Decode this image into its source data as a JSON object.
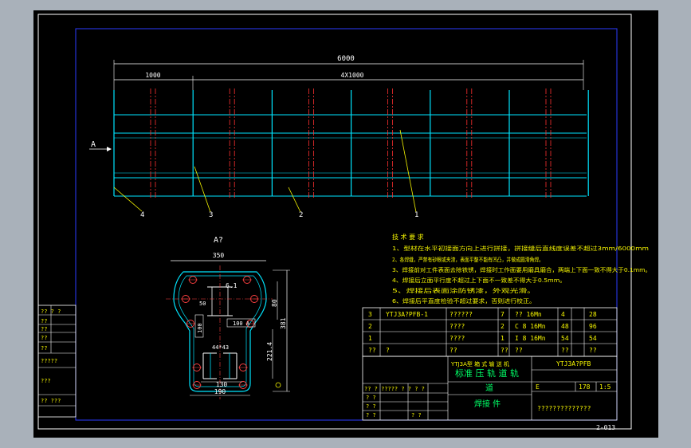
{
  "colors": {
    "background": "#000000",
    "border": "#ffffff",
    "inner_frame": "#2b3bff",
    "steel": "#00e5ff",
    "center_line": "#ff3030",
    "text": "#ffffff",
    "notes": "#f5f500",
    "detail": "#ff4040",
    "dimension": "#ffffff",
    "table_line": "#ffffff",
    "table_text": "#f5f500",
    "title_text": "#00ff66"
  },
  "drawing": {
    "dim_total": "6000",
    "dim_first": "1000",
    "dim_spacing": "4X1000",
    "section_marker": "A",
    "callouts": [
      "4",
      "3",
      "2",
      "1"
    ],
    "section_view_title": "A?",
    "section_dims": {
      "width_top": "350",
      "height_right": "381",
      "dim_80": "80",
      "dim_221": "221.4",
      "dim_50": "50",
      "dim_100a": "100 A",
      "dim_100": "100",
      "dim_130": "130",
      "dim_190": "190",
      "dim_443": "44*43",
      "dim_61": "6.1"
    },
    "sheet_number": "2-013"
  },
  "notes": {
    "title": "技 术 要 求",
    "lines": [
      "1、型材在水平初接面方向上进行拼接，拼接缝后直线度误差不超过3mm/6000mm",
      "2、各焊缝，严禁有砂眼或夹渣，表面平整不能有凹凸，并做成圆滑角焊。",
      "3、焊接前对工件表面去除铁锈，焊接时工作面要用磨具磨合，两端上下面一致不得大于0.1mm。",
      "4、焊接后立面平行度不超过上下面不一致差不得大于0.5mm。",
      "5、焊接后表面涂防锈漆，外观光滑。",
      "6、焊接后平直度检验不超过要求，否则进行校正。"
    ]
  },
  "left_table": {
    "rows": [
      "?? ? ?",
      "??",
      "??",
      "??",
      "??",
      "?????",
      "???",
      "?? ???"
    ]
  },
  "bom": {
    "rows": [
      {
        "no": "3",
        "code": "YTJ3A?PFB-1",
        "name": "??????",
        "qty": "7",
        "spec": "?? 16Mn",
        "u": "4",
        "t": "28"
      },
      {
        "no": "2",
        "code": "",
        "name": "????",
        "qty": "2",
        "spec": "C 8  16Mn",
        "u": "48",
        "t": "96"
      },
      {
        "no": "1",
        "code": "",
        "name": "????",
        "qty": "1",
        "spec": "I 8  16Mn",
        "u": "54",
        "t": "54"
      },
      {
        "no": "??",
        "code": "?",
        "name": "??",
        "qty": "??",
        "spec": "??",
        "u": "??",
        "t": "??"
      }
    ]
  },
  "title_block": {
    "project_code": "YTJ3A型 箱 式 输 送 机",
    "part_name_1": "标准 压 轨 道 轨",
    "part_name_2": "道",
    "part_name_3": "焊接 件",
    "drawing_code": "YTJ3A?PFB",
    "scale_label": "E",
    "weight": "178",
    "scale": "1:5",
    "bottom_code": "??????????????",
    "sign_rows": [
      "?? ? ?????   ? ?  ? ?",
      "? ?",
      "? ?",
      "? ?",
      "? ?"
    ]
  }
}
